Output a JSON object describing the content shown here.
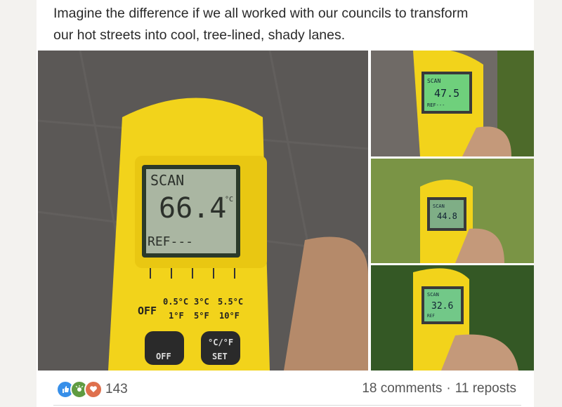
{
  "post": {
    "text_line1": "Imagine the difference if we all worked with our councils to transform",
    "text_line2": "our hot streets into cool, tree-lined, shady lanes."
  },
  "photos": {
    "main": {
      "mode": "SCAN",
      "reading": "66.4",
      "unit": "°C",
      "ref": "REF---",
      "buttons": [
        "OFF",
        "0.5°C",
        "1°F",
        "3°C",
        "5°F",
        "5.5°C",
        "10°F"
      ],
      "key_left": "OFF",
      "key_right_top": "°C/°F",
      "key_right_bottom": "SET"
    },
    "thumbs": [
      {
        "surface": "asphalt",
        "mode": "SCAN",
        "reading": "47.5",
        "ref": "REF---"
      },
      {
        "surface": "grass",
        "mode": "SCAN",
        "reading": "44.8",
        "ref": ""
      },
      {
        "surface": "ground-cover",
        "mode": "SCAN",
        "reading": "32.6",
        "ref": "REF"
      }
    ]
  },
  "social": {
    "reaction_count": "143",
    "comments": "18 comments",
    "separator": "·",
    "reposts": "11 reposts",
    "reactions": [
      "like",
      "celebrate",
      "love"
    ],
    "reaction_colors": {
      "like": "#378fe9",
      "celebrate": "#5f9b41",
      "love": "#df704d"
    }
  },
  "colors": {
    "meter_yellow": "#f2d31b",
    "lcd_green": "#7ed08c"
  }
}
